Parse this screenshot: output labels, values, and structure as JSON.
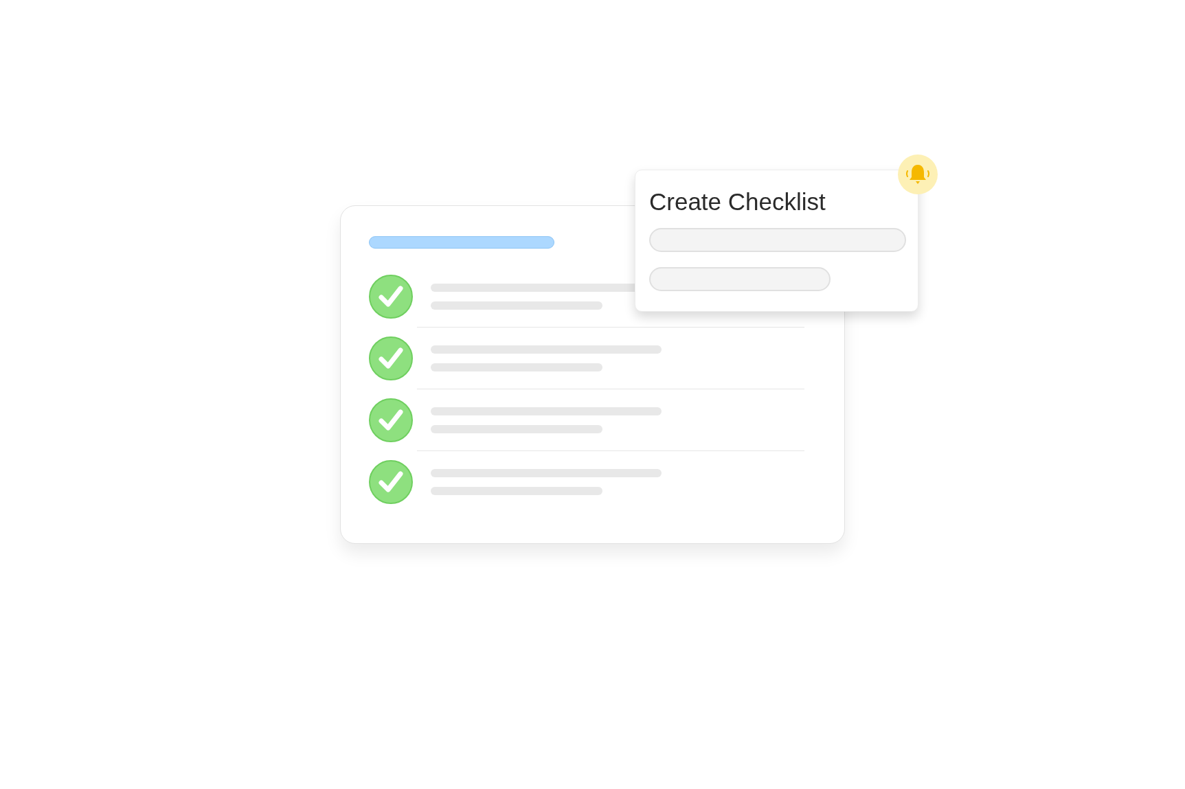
{
  "checklist": {
    "items": [
      {
        "checked": true
      },
      {
        "checked": true
      },
      {
        "checked": true
      },
      {
        "checked": true
      }
    ]
  },
  "dialog": {
    "title": "Create Checklist"
  }
}
